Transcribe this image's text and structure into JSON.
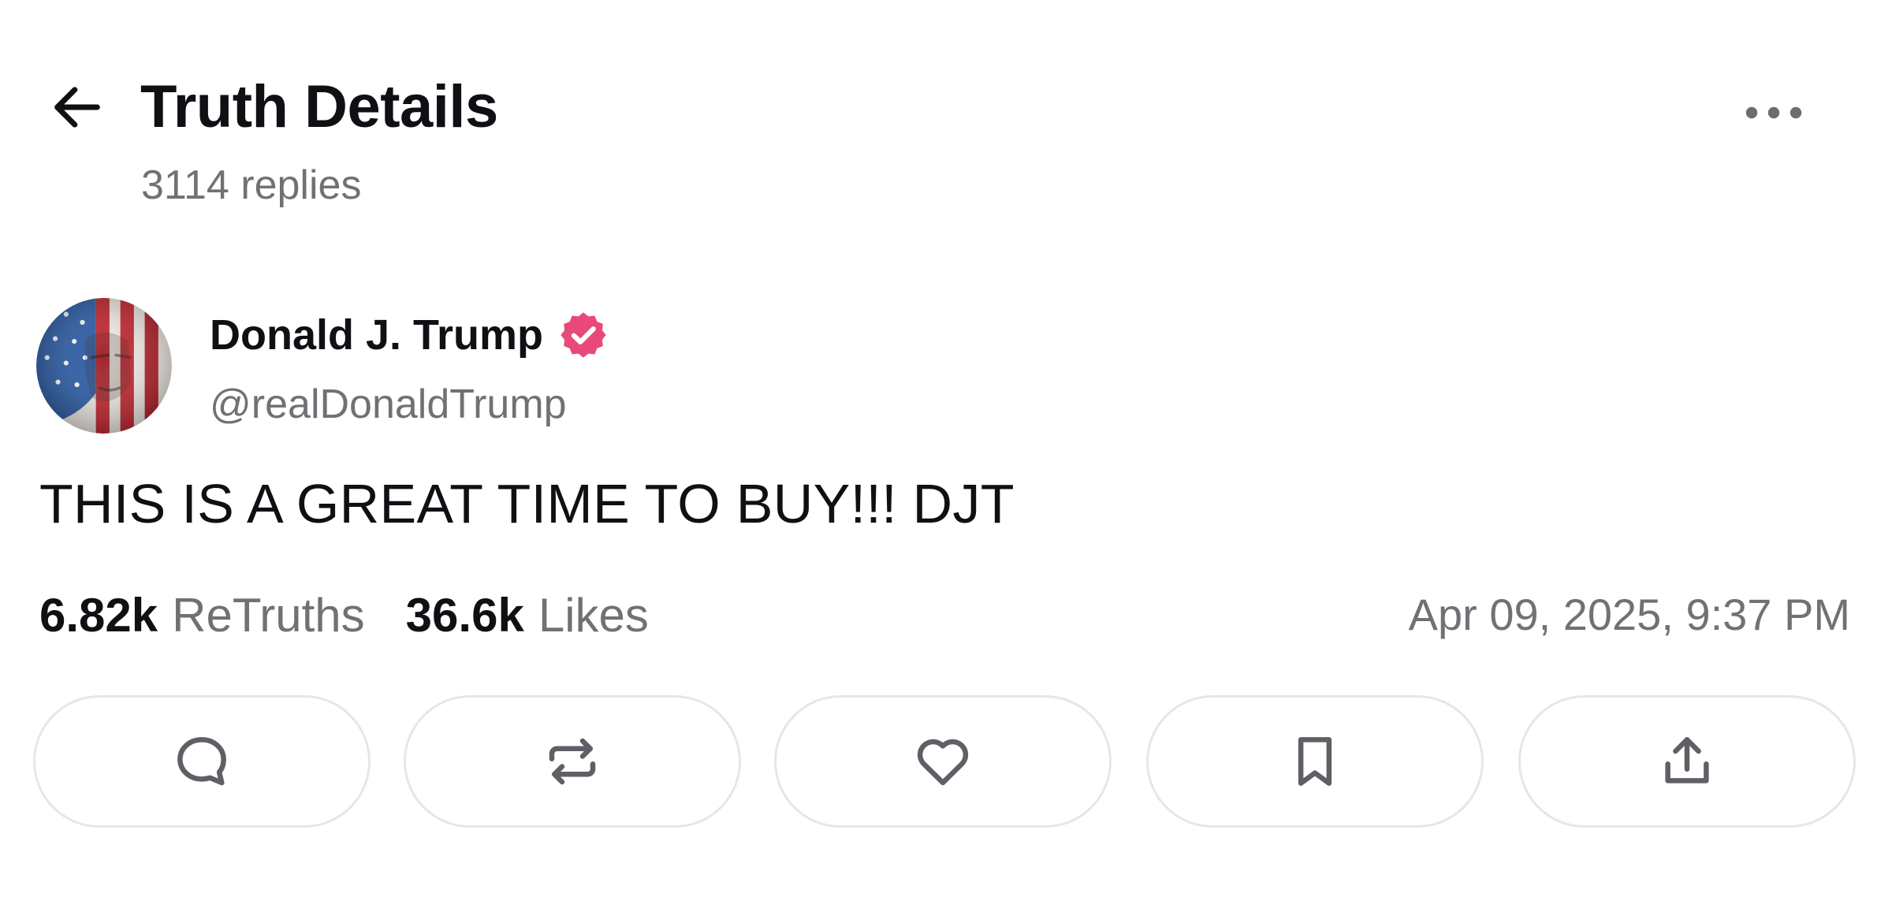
{
  "header": {
    "title": "Truth Details",
    "reply_count": "3114 replies",
    "back_icon": "arrow-left-icon",
    "more_icon": "more-horizontal-icon"
  },
  "author": {
    "name": "Donald J. Trump",
    "handle": "@realDonaldTrump",
    "verified": true,
    "verified_color": "#e8487a"
  },
  "post": {
    "text": "THIS IS A GREAT TIME TO BUY!!! DJT"
  },
  "stats": {
    "retruths_count": "6.82k",
    "retruths_label": "ReTruths",
    "likes_count": "36.6k",
    "likes_label": "Likes",
    "timestamp": "Apr 09, 2025, 9:37 PM"
  },
  "actions": [
    {
      "name": "reply",
      "icon": "comment-icon"
    },
    {
      "name": "retruth",
      "icon": "repost-icon"
    },
    {
      "name": "like",
      "icon": "heart-icon"
    },
    {
      "name": "bookmark",
      "icon": "bookmark-icon"
    },
    {
      "name": "share",
      "icon": "share-icon"
    }
  ],
  "colors": {
    "text_primary": "#0f0f14",
    "text_secondary": "#717175",
    "button_border": "#e6e6ea",
    "icon_gray": "#5f5f66"
  }
}
